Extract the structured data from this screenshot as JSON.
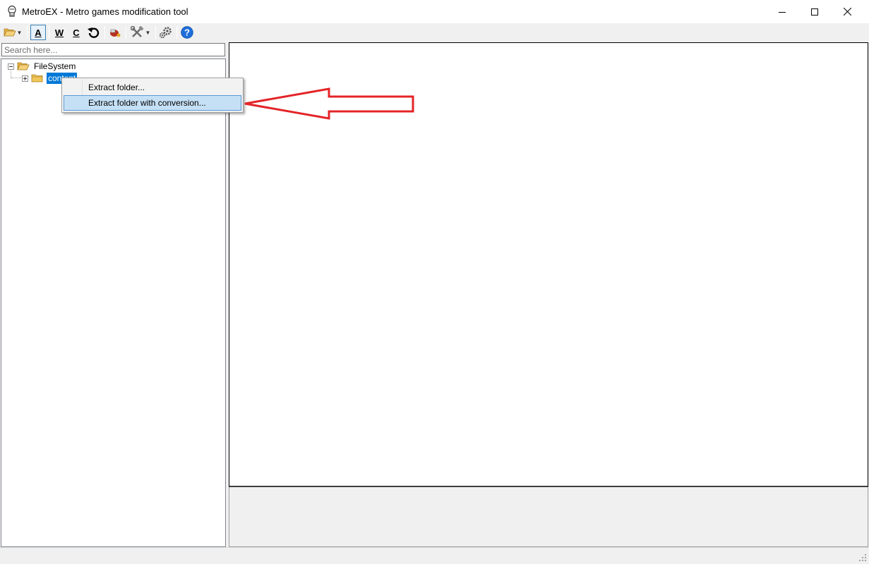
{
  "window": {
    "title": "MetroEX - Metro games modification tool",
    "controls": {
      "minimize": "minimize",
      "maximize": "maximize",
      "close": "close"
    }
  },
  "toolbar": {
    "items": [
      {
        "id": "open",
        "icon": "folder-open-icon",
        "has_dropdown": true
      },
      {
        "id": "a",
        "label": "A",
        "active": true
      },
      {
        "id": "w",
        "label": "W"
      },
      {
        "id": "c",
        "label": "C"
      },
      {
        "id": "undo",
        "icon": "undo-icon"
      },
      {
        "id": "converter",
        "icon": "converter-icon"
      },
      {
        "id": "tools",
        "icon": "tools-icon",
        "has_dropdown": true
      },
      {
        "id": "settings",
        "icon": "gear-icon"
      },
      {
        "id": "help",
        "icon": "help-icon"
      }
    ]
  },
  "search": {
    "placeholder": "Search here..."
  },
  "tree": {
    "root": {
      "label": "FileSystem",
      "expanded": true
    },
    "children": [
      {
        "label": "content",
        "selected": true,
        "expanded": false
      }
    ]
  },
  "context_menu": {
    "items": [
      {
        "label": "Extract folder..."
      },
      {
        "label": "Extract folder with conversion...",
        "highlighted": true
      }
    ]
  },
  "annotation": {
    "type": "arrow",
    "color": "#e32428",
    "points_to": "Extract folder with conversion..."
  },
  "colors": {
    "selection": "#0078d7",
    "menu_highlight": "#c5e0f5",
    "arrow": "#e32428",
    "help": "#1e6fd9"
  }
}
